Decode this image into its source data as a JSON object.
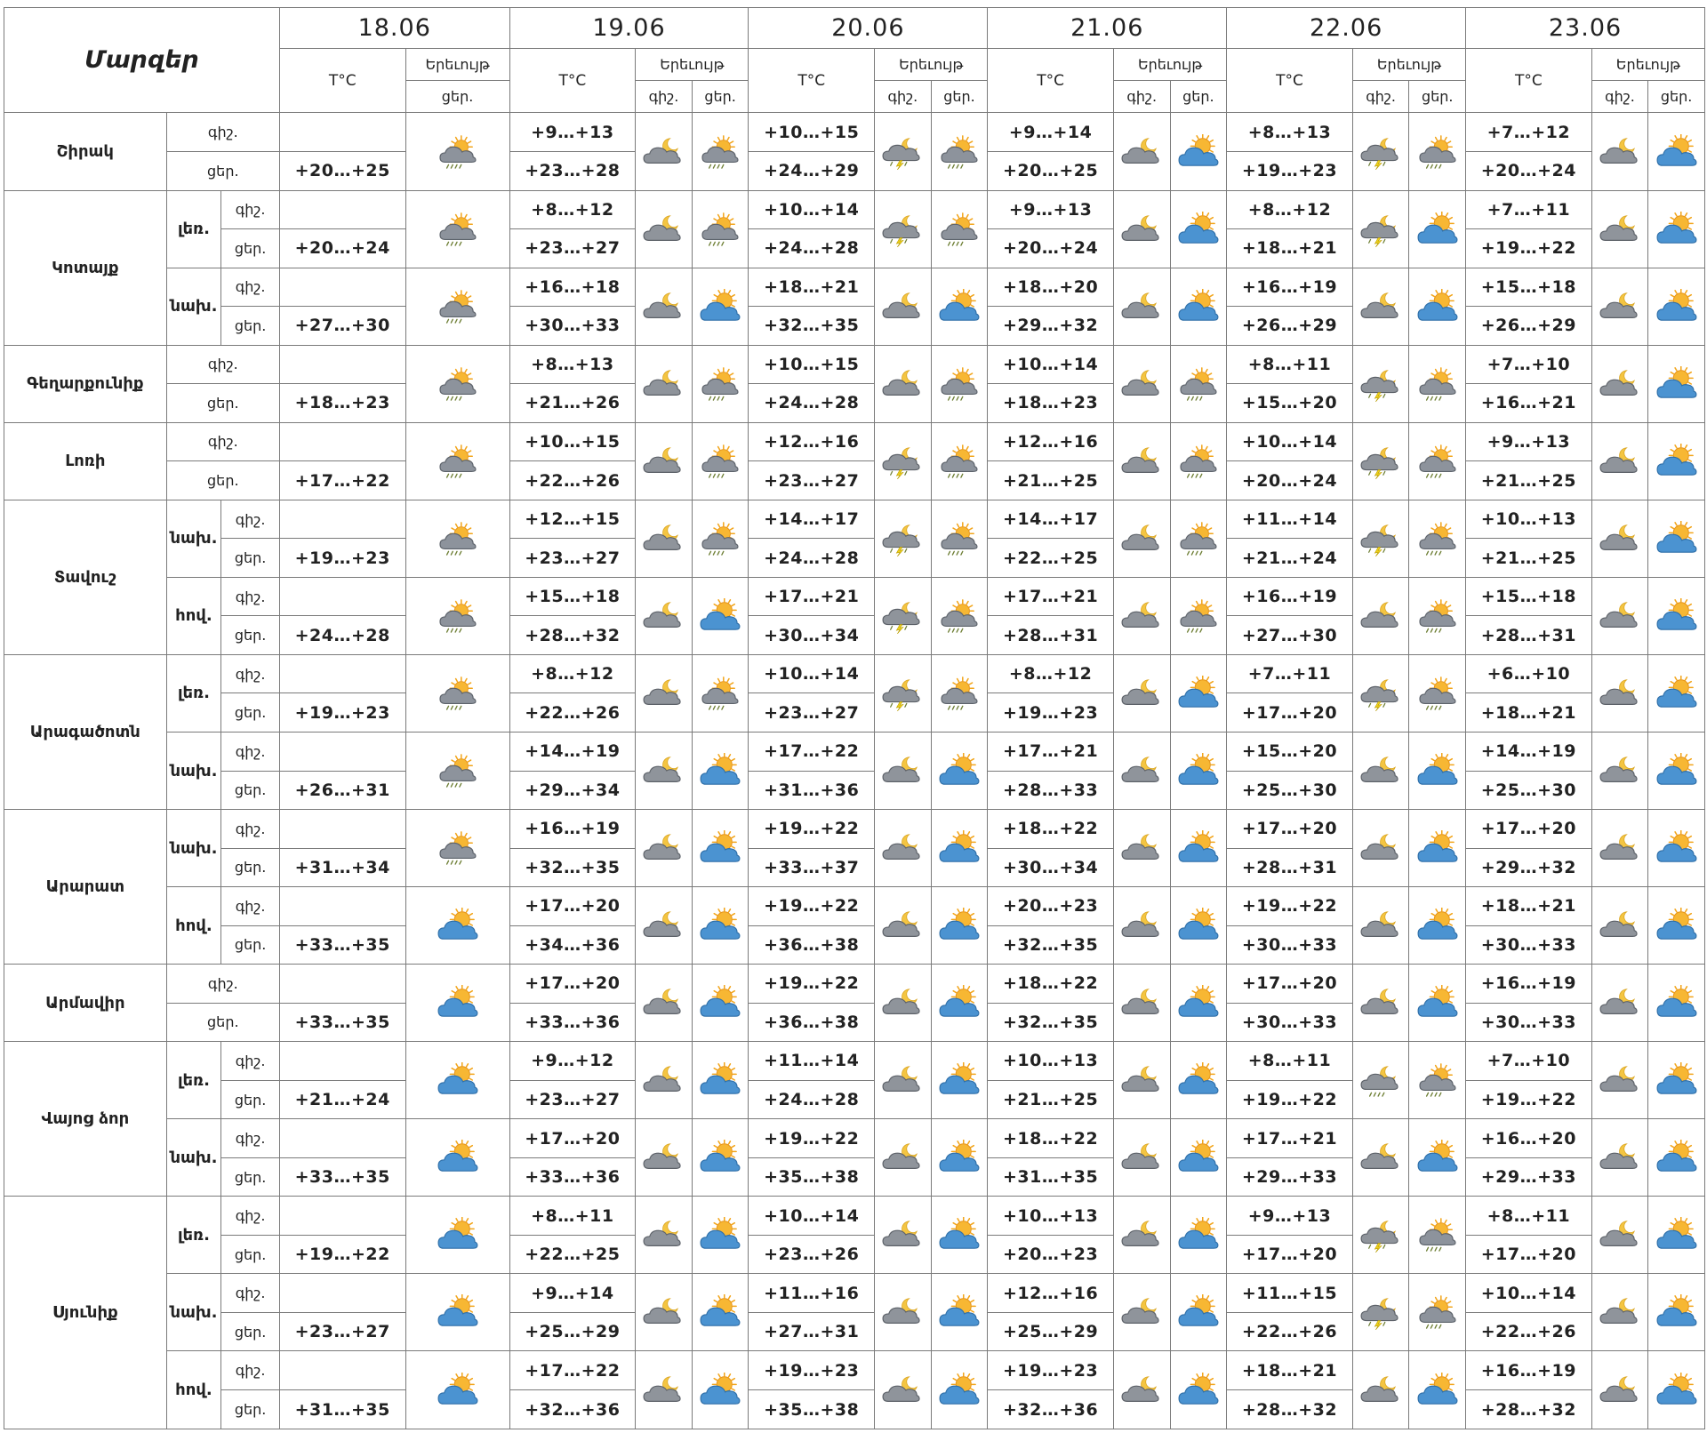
{
  "header": {
    "title": "Մարզեր",
    "t_label": "T°C",
    "phenomenon_label": "Երեւույթ",
    "night_label": "գիշ.",
    "day_label": "ցեր.",
    "dates": [
      "18.06",
      "19.06",
      "20.06",
      "21.06",
      "22.06",
      "23.06"
    ]
  },
  "icon_names": {
    "d1": "sun-cloud-rain-icon",
    "d2": "sun-cloud-icon",
    "n1": "moon-cloud-icon",
    "n2": "moon-cloud-storm-icon",
    "n3": "moon-cloud-rain-icon"
  },
  "regions": [
    {
      "name": "Շիրակ",
      "subs": [
        {
          "label": "",
          "night": [
            "",
            "+9…+13",
            "+10…+15",
            "+9…+14",
            "+8…+13",
            "+7…+12"
          ],
          "day": [
            "+20…+25",
            "+23…+28",
            "+24…+29",
            "+20…+25",
            "+19…+23",
            "+20…+24"
          ],
          "ni": [
            "",
            "n1",
            "n2",
            "n1",
            "n2",
            "n1"
          ],
          "di": [
            "d1",
            "d1",
            "d1",
            "d2",
            "d1",
            "d2"
          ]
        }
      ]
    },
    {
      "name": "Կոտայք",
      "subs": [
        {
          "label": "լեռ.",
          "night": [
            "",
            "+8…+12",
            "+10…+14",
            "+9…+13",
            "+8…+12",
            "+7…+11"
          ],
          "day": [
            "+20…+24",
            "+23…+27",
            "+24…+28",
            "+20…+24",
            "+18…+21",
            "+19…+22"
          ],
          "ni": [
            "",
            "n1",
            "n2",
            "n1",
            "n2",
            "n1"
          ],
          "di": [
            "d1",
            "d1",
            "d1",
            "d2",
            "d2",
            "d2"
          ]
        },
        {
          "label": "նախ.",
          "night": [
            "",
            "+16…+18",
            "+18…+21",
            "+18…+20",
            "+16…+19",
            "+15…+18"
          ],
          "day": [
            "+27…+30",
            "+30…+33",
            "+32…+35",
            "+29…+32",
            "+26…+29",
            "+26…+29"
          ],
          "ni": [
            "",
            "n1",
            "n1",
            "n1",
            "n1",
            "n1"
          ],
          "di": [
            "d1",
            "d2",
            "d2",
            "d2",
            "d2",
            "d2"
          ]
        }
      ]
    },
    {
      "name": "Գեղարքունիք",
      "subs": [
        {
          "label": "",
          "night": [
            "",
            "+8…+13",
            "+10…+15",
            "+10…+14",
            "+8…+11",
            "+7…+10"
          ],
          "day": [
            "+18…+23",
            "+21…+26",
            "+24…+28",
            "+18…+23",
            "+15…+20",
            "+16…+21"
          ],
          "ni": [
            "",
            "n1",
            "n1",
            "n1",
            "n2",
            "n1"
          ],
          "di": [
            "d1",
            "d1",
            "d1",
            "d1",
            "d1",
            "d2"
          ]
        }
      ]
    },
    {
      "name": "Լոռի",
      "subs": [
        {
          "label": "",
          "night": [
            "",
            "+10…+15",
            "+12…+16",
            "+12…+16",
            "+10…+14",
            "+9…+13"
          ],
          "day": [
            "+17…+22",
            "+22…+26",
            "+23…+27",
            "+21…+25",
            "+20…+24",
            "+21…+25"
          ],
          "ni": [
            "",
            "n1",
            "n2",
            "n1",
            "n2",
            "n1"
          ],
          "di": [
            "d1",
            "d1",
            "d1",
            "d1",
            "d1",
            "d2"
          ]
        }
      ]
    },
    {
      "name": "Տավուշ",
      "subs": [
        {
          "label": "նախ.",
          "night": [
            "",
            "+12…+15",
            "+14…+17",
            "+14…+17",
            "+11…+14",
            "+10…+13"
          ],
          "day": [
            "+19…+23",
            "+23…+27",
            "+24…+28",
            "+22…+25",
            "+21…+24",
            "+21…+25"
          ],
          "ni": [
            "",
            "n1",
            "n2",
            "n1",
            "n2",
            "n1"
          ],
          "di": [
            "d1",
            "d1",
            "d1",
            "d1",
            "d1",
            "d2"
          ]
        },
        {
          "label": "հով.",
          "night": [
            "",
            "+15…+18",
            "+17…+21",
            "+17…+21",
            "+16…+19",
            "+15…+18"
          ],
          "day": [
            "+24…+28",
            "+28…+32",
            "+30…+34",
            "+28…+31",
            "+27…+30",
            "+28…+31"
          ],
          "ni": [
            "",
            "n1",
            "n2",
            "n1",
            "n1",
            "n1"
          ],
          "di": [
            "d1",
            "d2",
            "d1",
            "d1",
            "d1",
            "d2"
          ]
        }
      ]
    },
    {
      "name": "Արագածոտն",
      "subs": [
        {
          "label": "լեռ.",
          "night": [
            "",
            "+8…+12",
            "+10…+14",
            "+8…+12",
            "+7…+11",
            "+6…+10"
          ],
          "day": [
            "+19…+23",
            "+22…+26",
            "+23…+27",
            "+19…+23",
            "+17…+20",
            "+18…+21"
          ],
          "ni": [
            "",
            "n1",
            "n2",
            "n1",
            "n2",
            "n1"
          ],
          "di": [
            "d1",
            "d1",
            "d1",
            "d2",
            "d1",
            "d2"
          ]
        },
        {
          "label": "նախ.",
          "night": [
            "",
            "+14…+19",
            "+17…+22",
            "+17…+21",
            "+15…+20",
            "+14…+19"
          ],
          "day": [
            "+26…+31",
            "+29…+34",
            "+31…+36",
            "+28…+33",
            "+25…+30",
            "+25…+30"
          ],
          "ni": [
            "",
            "n1",
            "n1",
            "n1",
            "n1",
            "n1"
          ],
          "di": [
            "d1",
            "d2",
            "d2",
            "d2",
            "d2",
            "d2"
          ]
        }
      ]
    },
    {
      "name": "Արարատ",
      "subs": [
        {
          "label": "նախ.",
          "night": [
            "",
            "+16…+19",
            "+19…+22",
            "+18…+22",
            "+17…+20",
            "+17…+20"
          ],
          "day": [
            "+31…+34",
            "+32…+35",
            "+33…+37",
            "+30…+34",
            "+28…+31",
            "+29…+32"
          ],
          "ni": [
            "",
            "n1",
            "n1",
            "n1",
            "n1",
            "n1"
          ],
          "di": [
            "d1",
            "d2",
            "d2",
            "d2",
            "d2",
            "d2"
          ]
        },
        {
          "label": "հով.",
          "night": [
            "",
            "+17…+20",
            "+19…+22",
            "+20…+23",
            "+19…+22",
            "+18…+21"
          ],
          "day": [
            "+33…+35",
            "+34…+36",
            "+36…+38",
            "+32…+35",
            "+30…+33",
            "+30…+33"
          ],
          "ni": [
            "",
            "n1",
            "n1",
            "n1",
            "n1",
            "n1"
          ],
          "di": [
            "d2",
            "d2",
            "d2",
            "d2",
            "d2",
            "d2"
          ]
        }
      ]
    },
    {
      "name": "Արմավիր",
      "subs": [
        {
          "label": "",
          "night": [
            "",
            "+17…+20",
            "+19…+22",
            "+18…+22",
            "+17…+20",
            "+16…+19"
          ],
          "day": [
            "+33…+35",
            "+33…+36",
            "+36…+38",
            "+32…+35",
            "+30…+33",
            "+30…+33"
          ],
          "ni": [
            "",
            "n1",
            "n1",
            "n1",
            "n1",
            "n1"
          ],
          "di": [
            "d2",
            "d2",
            "d2",
            "d2",
            "d2",
            "d2"
          ]
        }
      ]
    },
    {
      "name": "Վայոց ձոր",
      "subs": [
        {
          "label": "լեռ.",
          "night": [
            "",
            "+9…+12",
            "+11…+14",
            "+10…+13",
            "+8…+11",
            "+7…+10"
          ],
          "day": [
            "+21…+24",
            "+23…+27",
            "+24…+28",
            "+21…+25",
            "+19…+22",
            "+19…+22"
          ],
          "ni": [
            "",
            "n1",
            "n1",
            "n1",
            "n3",
            "n1"
          ],
          "di": [
            "d2",
            "d2",
            "d2",
            "d2",
            "d1",
            "d2"
          ]
        },
        {
          "label": "նախ.",
          "night": [
            "",
            "+17…+20",
            "+19…+22",
            "+18…+22",
            "+17…+21",
            "+16…+20"
          ],
          "day": [
            "+33…+35",
            "+33…+36",
            "+35…+38",
            "+31…+35",
            "+29…+33",
            "+29…+33"
          ],
          "ni": [
            "",
            "n1",
            "n1",
            "n1",
            "n1",
            "n1"
          ],
          "di": [
            "d2",
            "d2",
            "d2",
            "d2",
            "d2",
            "d2"
          ]
        }
      ]
    },
    {
      "name": "Սյունիք",
      "subs": [
        {
          "label": "լեռ.",
          "night": [
            "",
            "+8…+11",
            "+10…+14",
            "+10…+13",
            "+9…+13",
            "+8…+11"
          ],
          "day": [
            "+19…+22",
            "+22…+25",
            "+23…+26",
            "+20…+23",
            "+17…+20",
            "+17…+20"
          ],
          "ni": [
            "",
            "n1",
            "n1",
            "n1",
            "n2",
            "n1"
          ],
          "di": [
            "d2",
            "d2",
            "d2",
            "d2",
            "d1",
            "d2"
          ]
        },
        {
          "label": "նախ.",
          "night": [
            "",
            "+9…+14",
            "+11…+16",
            "+12…+16",
            "+11…+15",
            "+10…+14"
          ],
          "day": [
            "+23…+27",
            "+25…+29",
            "+27…+31",
            "+25…+29",
            "+22…+26",
            "+22…+26"
          ],
          "ni": [
            "",
            "n1",
            "n1",
            "n1",
            "n2",
            "n1"
          ],
          "di": [
            "d2",
            "d2",
            "d2",
            "d2",
            "d1",
            "d2"
          ]
        },
        {
          "label": "հով.",
          "night": [
            "",
            "+17…+22",
            "+19…+23",
            "+19…+23",
            "+18…+21",
            "+16…+19"
          ],
          "day": [
            "+31…+35",
            "+32…+36",
            "+35…+38",
            "+32…+36",
            "+28…+32",
            "+28…+32"
          ],
          "ni": [
            "",
            "n1",
            "n1",
            "n1",
            "n1",
            "n1"
          ],
          "di": [
            "d2",
            "d2",
            "d2",
            "d2",
            "d2",
            "d2"
          ]
        }
      ]
    }
  ]
}
